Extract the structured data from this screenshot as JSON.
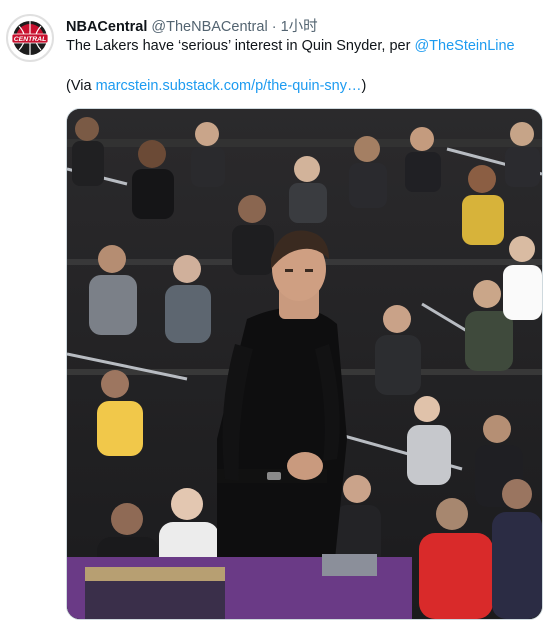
{
  "tweet": {
    "author_name": "NBACentral",
    "handle": "@TheNBACentral",
    "separator": "·",
    "time": "1小时",
    "text_before_mention": "The Lakers have ‘serious’ interest in Quin Snyder, per ",
    "mention": "@TheSteinLine",
    "via_prefix": "(Via ",
    "via_link": "marcstein.substack.com/p/the-quin-sny…",
    "via_suffix": ")",
    "avatar_icon": "nba-central-logo-icon",
    "avatar_text": "CENTRAL",
    "media_icon": "photo-coach-courtside-icon"
  },
  "colors": {
    "link": "#1d9bf0",
    "secondary_text": "#536471",
    "avatar_red": "#c8102e"
  }
}
